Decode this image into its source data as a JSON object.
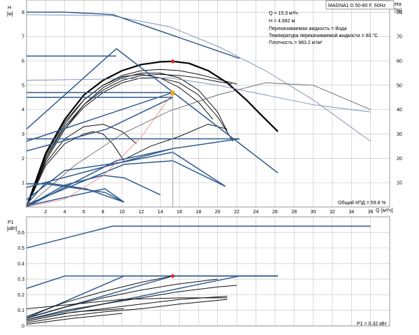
{
  "chart_data": [
    {
      "type": "line",
      "title": "MAGNA1 D 50-80 F, 50Hz",
      "info_lines": [
        "Q = 15.3 м³/ч",
        "H = 4.682 м",
        "Перекачиваемая жидкость = Вода",
        "Температура перекачиваемой жидкости = 60 °C",
        "Плотность = 983.2 кг/м³"
      ],
      "ylabel": "H",
      "yunit": "[м]",
      "y2label": "eta",
      "y2unit": "[%]",
      "xlabel": "Q",
      "xunit": "[м³/ч]",
      "xlim": [
        0,
        38
      ],
      "ylim": [
        0,
        8.5
      ],
      "y2lim": [
        0,
        85
      ],
      "x_ticks": [
        "2",
        "4",
        "6",
        "8",
        "10",
        "12",
        "14",
        "16",
        "18",
        "20",
        "22",
        "24",
        "26",
        "28",
        "30",
        "32",
        "34",
        "36"
      ],
      "y_ticks": [
        "1",
        "2",
        "3",
        "4",
        "5",
        "6",
        "7",
        "8"
      ],
      "y2_ticks": [
        "10",
        "20",
        "30",
        "40",
        "50",
        "60",
        "70",
        "80"
      ],
      "grid": true,
      "efficiency_label": "Общий КПД = 59.8 %",
      "duty_point": {
        "x": 15.3,
        "y": 4.682
      },
      "best_point": {
        "x": 15.3,
        "y": 5.98
      },
      "colors": {
        "curve": "#000000",
        "limit": "#2f5b8f",
        "duty": "#ffb400",
        "marker": "#e02020",
        "system": "#f08080",
        "eta": "#555555",
        "grid": "#c8c8c8"
      },
      "series": [
        {
          "kind": "selected",
          "x": [
            0,
            2,
            4,
            6,
            8,
            10,
            12,
            14,
            15.3,
            17,
            19,
            21,
            23,
            24.5,
            26.3
          ],
          "y": [
            0,
            2.2,
            3.6,
            4.6,
            5.2,
            5.6,
            5.85,
            5.96,
            5.98,
            5.9,
            5.6,
            5.1,
            4.4,
            3.8,
            3.1
          ]
        },
        {
          "kind": "curve",
          "x": [
            0,
            2,
            4,
            6,
            8,
            10,
            12,
            14,
            16,
            18,
            20,
            22
          ],
          "y": [
            0,
            2.1,
            3.5,
            4.4,
            5.0,
            5.4,
            5.6,
            5.65,
            5.6,
            5.45,
            5.25,
            5.05
          ]
        },
        {
          "kind": "curve",
          "x": [
            0,
            2,
            4,
            6,
            8,
            10,
            12,
            14,
            16,
            18,
            20,
            21.5
          ],
          "y": [
            0,
            2.0,
            3.3,
            4.2,
            4.8,
            5.2,
            5.4,
            5.45,
            5.4,
            5.3,
            5.15,
            5.05
          ]
        },
        {
          "kind": "curve",
          "x": [
            0,
            2,
            4,
            6,
            8,
            10,
            12,
            14,
            16,
            18,
            19.5
          ],
          "y": [
            0,
            2.0,
            3.4,
            4.4,
            5.0,
            5.35,
            5.45,
            5.3,
            4.9,
            4.3,
            3.6
          ]
        },
        {
          "kind": "curve",
          "x": [
            0,
            2,
            4,
            6,
            8,
            10,
            12,
            14,
            16,
            18,
            20,
            21
          ],
          "y": [
            0,
            1.9,
            3.2,
            4.2,
            4.9,
            5.3,
            5.5,
            5.5,
            5.3,
            4.8,
            3.9,
            3.1
          ]
        },
        {
          "kind": "curve",
          "x": [
            0,
            2,
            4,
            6,
            8,
            10,
            12,
            14,
            16,
            18,
            20,
            21.6
          ],
          "y": [
            0,
            1.9,
            3.2,
            4.1,
            4.7,
            5.1,
            5.3,
            5.3,
            5.1,
            4.6,
            3.7,
            2.7
          ]
        },
        {
          "kind": "curve",
          "x": [
            0,
            2,
            4,
            6,
            8,
            10,
            11.5
          ],
          "y": [
            0,
            1.8,
            2.8,
            3.3,
            3.4,
            3.1,
            2.6
          ]
        },
        {
          "kind": "curve",
          "x": [
            0,
            2,
            4,
            6,
            7,
            8,
            9,
            10.2
          ],
          "y": [
            0,
            1.7,
            2.6,
            3.0,
            3.1,
            3.0,
            2.6,
            1.9
          ]
        },
        {
          "kind": "curve",
          "x": [
            10.2,
            13,
            16,
            19,
            21
          ],
          "y": [
            1.95,
            2.5,
            2.9,
            3.4,
            3.2
          ]
        },
        {
          "kind": "limit",
          "x": [
            0,
            4,
            9,
            22.3
          ],
          "y": [
            8.0,
            8.0,
            7.9,
            6.1
          ]
        },
        {
          "kind": "limit",
          "x": [
            0,
            9.4,
            26.3
          ],
          "y": [
            3.2,
            6.5,
            1.4
          ]
        },
        {
          "kind": "limit",
          "x": [
            0,
            9.4
          ],
          "y": [
            6.2,
            6.2
          ]
        },
        {
          "kind": "limit",
          "x": [
            0,
            15.3
          ],
          "y": [
            4.7,
            4.7
          ]
        },
        {
          "kind": "limit",
          "x": [
            0,
            15.3
          ],
          "y": [
            4.5,
            4.5
          ]
        },
        {
          "kind": "limit",
          "x": [
            0,
            8.4,
            15.3
          ],
          "y": [
            2.3,
            3.2,
            4.5
          ]
        },
        {
          "kind": "limit",
          "x": [
            0,
            15.3
          ],
          "y": [
            2.7,
            4.7
          ]
        },
        {
          "kind": "limit",
          "x": [
            0,
            15.3,
            22.3
          ],
          "y": [
            0.8,
            2.4,
            2.8
          ]
        },
        {
          "kind": "limit",
          "x": [
            0,
            22.3
          ],
          "y": [
            2.8,
            2.8
          ]
        },
        {
          "kind": "limit",
          "x": [
            0,
            9.4,
            15.3
          ],
          "y": [
            0,
            1.9,
            2.4
          ]
        },
        {
          "kind": "limit",
          "x": [
            0,
            2,
            8.2,
            10.2
          ],
          "y": [
            0.95,
            0.95,
            0.6,
            0.2
          ]
        },
        {
          "kind": "limit",
          "x": [
            0,
            4,
            10.2,
            15.3,
            20.8
          ],
          "y": [
            0.3,
            1.5,
            1.85,
            2.25,
            0.85
          ]
        },
        {
          "kind": "limit",
          "x": [
            0,
            10.2,
            15.3,
            20.8
          ],
          "y": [
            0.1,
            1.75,
            1.9,
            0.85
          ]
        },
        {
          "kind": "limit",
          "x": [
            0,
            4,
            8,
            10.2,
            14
          ],
          "y": [
            0.02,
            0.9,
            1.3,
            1.2,
            0.5
          ]
        },
        {
          "kind": "limit",
          "x": [
            0,
            8.2,
            10.2
          ],
          "y": [
            0.05,
            0.75,
            0.2
          ]
        },
        {
          "kind": "limit",
          "x": [
            0,
            2,
            6.2,
            10.2
          ],
          "y": [
            0.1,
            1.0,
            0.75,
            0.2
          ]
        },
        {
          "kind": "thin",
          "x": [
            0,
            9,
            15,
            20,
            25,
            30,
            36
          ],
          "y": [
            7.9,
            7.85,
            7.4,
            6.6,
            5.6,
            4.4,
            2.7
          ]
        },
        {
          "kind": "thin",
          "x": [
            0,
            15,
            20,
            25,
            30,
            36
          ],
          "y": [
            5.2,
            5.3,
            5.0,
            4.6,
            4.2,
            3.9
          ]
        },
        {
          "kind": "system",
          "x": [
            0,
            4,
            8,
            12,
            15.3
          ],
          "y": [
            0,
            0.32,
            1.28,
            2.87,
            4.68
          ]
        },
        {
          "kind": "eta",
          "x": [
            0,
            5,
            10,
            15,
            20,
            25,
            30,
            36
          ],
          "y": [
            0,
            1.7,
            3.0,
            3.95,
            4.6,
            5.1,
            5.0,
            4.0
          ]
        },
        {
          "kind": "duty-line",
          "x": [
            15.3,
            15.3
          ],
          "y": [
            0,
            4.682
          ]
        }
      ]
    },
    {
      "type": "line",
      "ylabel": "P1",
      "yunit": "[кВт]",
      "ylim": [
        0,
        0.7
      ],
      "y_ticks": [
        "0",
        "0.1",
        "0.2",
        "0.3",
        "0.4",
        "0.5",
        "0.6"
      ],
      "xlim": [
        0,
        38
      ],
      "grid": true,
      "power_label": "P1 = 0.32 кВт",
      "marker": {
        "x": 15.3,
        "y": 0.32
      },
      "series": [
        {
          "kind": "limit",
          "x": [
            0,
            9,
            36
          ],
          "y": [
            0.5,
            0.64,
            0.64
          ]
        },
        {
          "kind": "limit",
          "x": [
            0,
            4,
            26.3
          ],
          "y": [
            0.24,
            0.32,
            0.32
          ]
        },
        {
          "kind": "limit",
          "x": [
            0,
            10.2,
            26.3
          ],
          "y": [
            0.05,
            0.32,
            0.32
          ]
        },
        {
          "kind": "limit",
          "x": [
            0,
            15.3,
            26.3
          ],
          "y": [
            0.05,
            0.32,
            0.32
          ]
        },
        {
          "kind": "limit",
          "x": [
            0,
            22.3,
            26.3
          ],
          "y": [
            0.04,
            0.32,
            0.32
          ]
        },
        {
          "kind": "curve",
          "x": [
            0,
            4,
            8,
            12,
            15.3
          ],
          "y": [
            0.06,
            0.15,
            0.22,
            0.28,
            0.32
          ]
        },
        {
          "kind": "curve",
          "x": [
            0,
            4,
            8,
            12,
            16,
            20
          ],
          "y": [
            0.05,
            0.12,
            0.18,
            0.23,
            0.27,
            0.3
          ]
        },
        {
          "kind": "curve",
          "x": [
            0,
            4,
            8,
            12,
            16,
            20,
            22
          ],
          "y": [
            0.04,
            0.1,
            0.14,
            0.18,
            0.22,
            0.25,
            0.26
          ]
        },
        {
          "kind": "curve",
          "x": [
            0,
            4,
            8,
            12,
            16,
            21
          ],
          "y": [
            0.03,
            0.08,
            0.11,
            0.14,
            0.17,
            0.19
          ]
        },
        {
          "kind": "curve",
          "x": [
            0,
            4,
            8,
            12,
            16,
            21
          ],
          "y": [
            0.02,
            0.06,
            0.09,
            0.11,
            0.14,
            0.17
          ]
        },
        {
          "kind": "curve",
          "x": [
            0,
            10,
            16,
            21
          ],
          "y": [
            0.11,
            0.17,
            0.18,
            0.18
          ]
        },
        {
          "kind": "curve",
          "x": [
            0,
            5,
            10,
            10.2
          ],
          "y": [
            0.03,
            0.09,
            0.11,
            0.11
          ]
        },
        {
          "kind": "curve",
          "x": [
            0,
            5,
            10
          ],
          "y": [
            0.01,
            0.05,
            0.08
          ]
        }
      ]
    }
  ]
}
